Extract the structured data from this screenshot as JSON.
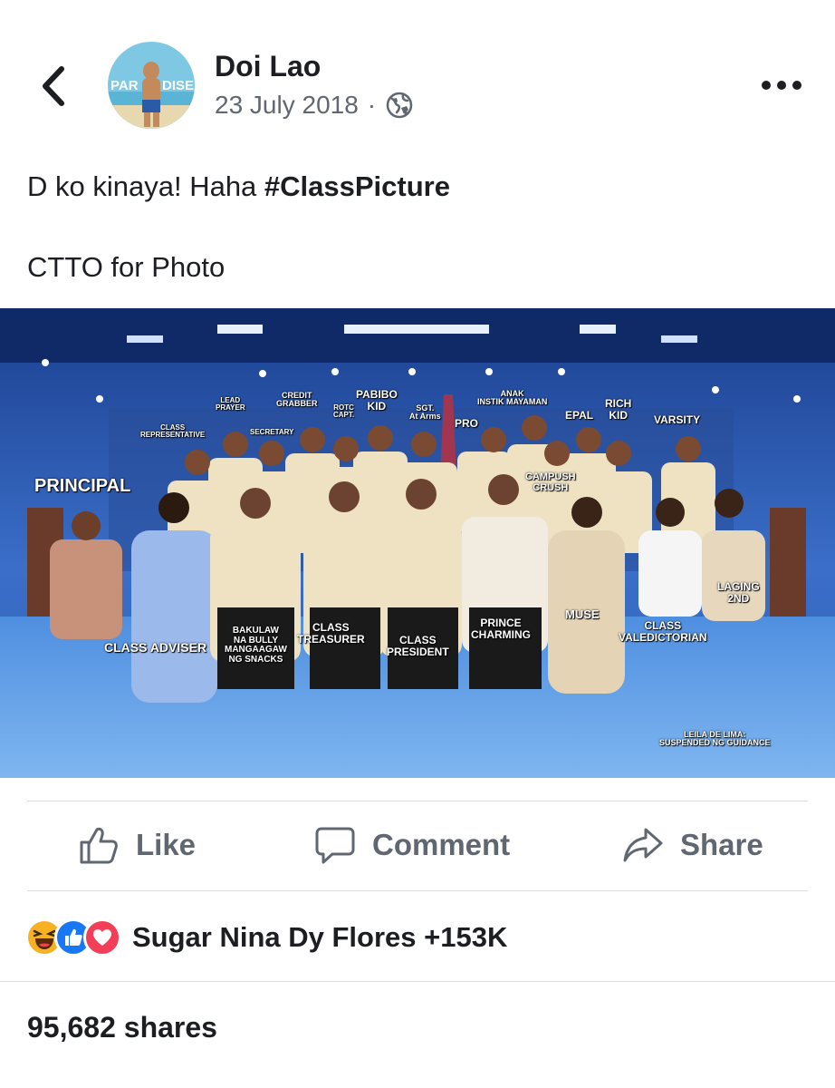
{
  "post": {
    "author": "Doi Lao",
    "date": "23 July 2018",
    "separator": "·",
    "privacy_icon": "globe-icon",
    "text_plain": "D ko kinaya! Haha ",
    "hashtag": "#ClassPicture",
    "credit": "CTTO for Photo"
  },
  "avatar": {
    "text_left": "PAR",
    "text_right": "DISE"
  },
  "photo": {
    "labels": {
      "principal": "PRINCIPAL",
      "class_adviser": "CLASS ADVISER",
      "class_representative": "CLASS\nREPRESENTATIVE",
      "lead_prayer": "LEAD\nPRAYER",
      "secretary": "SECRETARY",
      "credit_grabber": "CREDIT\nGRABBER",
      "rotc_capt": "ROTC\nCAPT.",
      "pabibo_kid": "PABIBO\nKID",
      "sgt_at_arms": "SGT.\nAt Arms",
      "pro": "PRO",
      "anak_instik": "ANAK\nINSTIK MAYAMAN",
      "epal": "EPAL",
      "rich_kid": "RICH\nKID",
      "varsity": "VARSITY",
      "campush_crush": "CAMPUSH\nCRUSH",
      "bakulaw": "BAKULAW\nNA BULLY\nMANGAAGAW\nNG SNACKS",
      "class_treasurer": "CLASS\nTREASURER",
      "class_president": "CLASS\nPRESIDENT",
      "prince_charming": "PRINCE\nCHARMING",
      "muse": "MUSE",
      "class_valedictorian": "CLASS\nVALEDICTORIAN",
      "laging_2nd": "LAGING\n2ND",
      "leila": "LEILA DE LIMA:\nSUSPENDED NG GUIDANCE"
    }
  },
  "actions": {
    "like": "Like",
    "comment": "Comment",
    "share": "Share"
  },
  "reactions": {
    "icons": [
      "haha-icon",
      "like-reaction-icon",
      "love-icon"
    ],
    "summary": "Sugar Nina Dy Flores +153K"
  },
  "shares": "95,682 shares",
  "colors": {
    "facebook_blue": "#1877f2",
    "love_red": "#f33e58",
    "haha_yellow": "#f7b125",
    "text_primary": "#1c1e21",
    "text_secondary": "#606770"
  }
}
